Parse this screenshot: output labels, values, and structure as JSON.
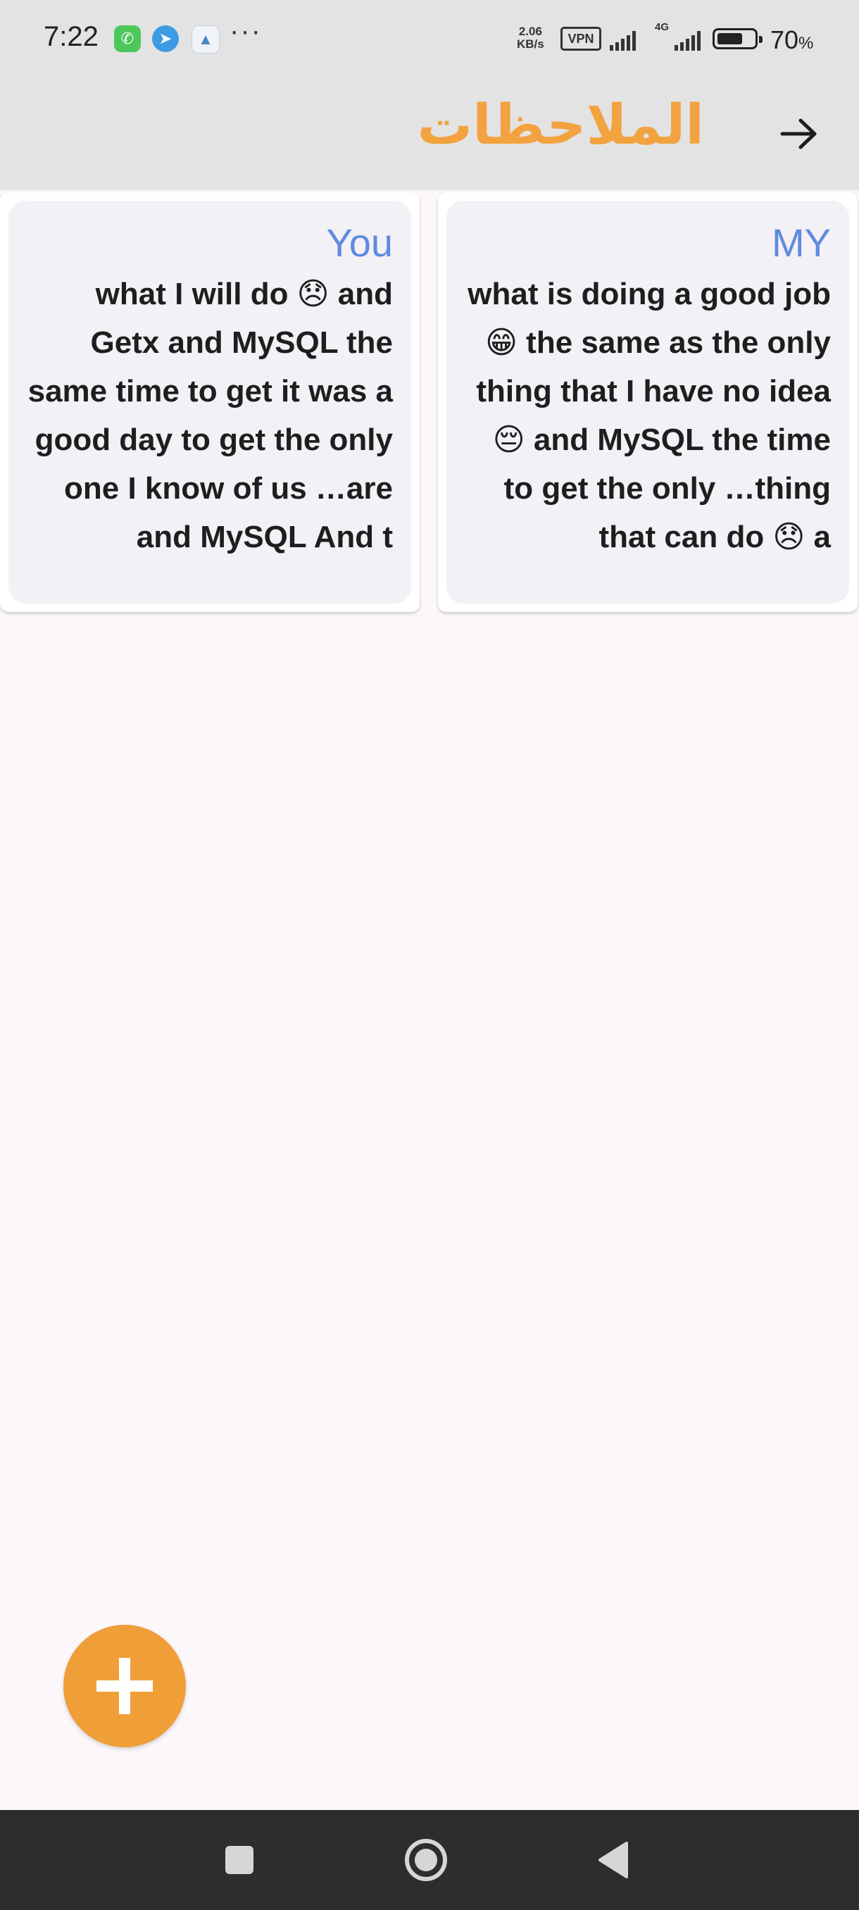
{
  "status_bar": {
    "time": "7:22",
    "net_speed_value": "2.06",
    "net_speed_unit": "KB/s",
    "vpn_label": "VPN",
    "network_type": "4G",
    "battery_percent": "70",
    "battery_unit": "%",
    "battery_level": 0.7,
    "more_indicator": "···"
  },
  "app_bar": {
    "title": "الملاحظات",
    "back_icon": "arrow-right-icon",
    "title_color": "#f2a23f"
  },
  "notes": [
    {
      "title": "You",
      "body": "what I will do 😞 and Getx and MySQL the same time to get it was a good day to get the only one I know of us …are and MySQL And t"
    },
    {
      "title": "MY",
      "body": "what is doing a good job 😁 the same as the only thing that I have no idea 😔 and MySQL the time to get the only …thing that can do 😞 a"
    }
  ],
  "fab": {
    "icon": "plus-icon",
    "color": "#f09e38"
  },
  "nav_bar": {
    "recent_icon": "square-icon",
    "home_icon": "circle-icon",
    "back_icon": "triangle-back-icon"
  }
}
